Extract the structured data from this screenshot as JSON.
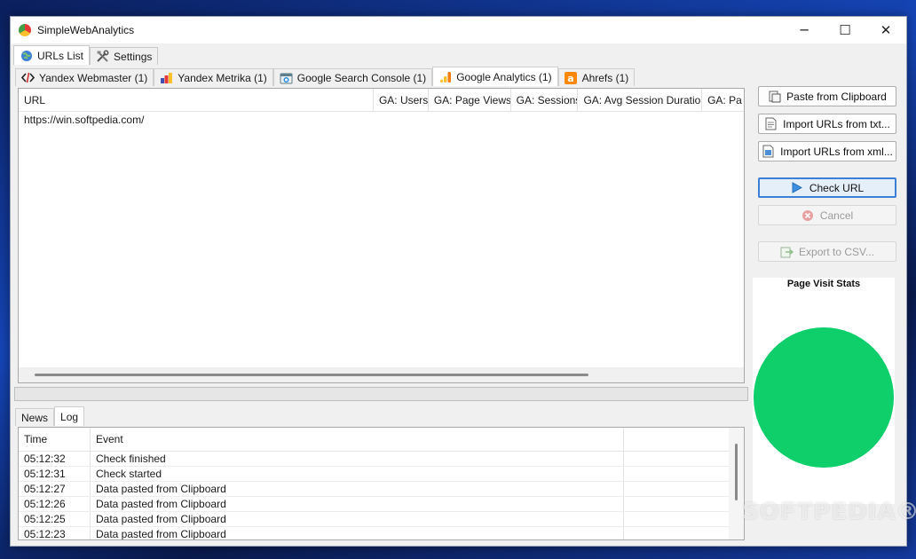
{
  "window": {
    "title": "SimpleWebAnalytics",
    "minimize": "─",
    "maximize": "☐",
    "close": "✕"
  },
  "top_tabs": [
    {
      "label": "URLs List",
      "icon": "globe-icon"
    },
    {
      "label": "Settings",
      "icon": "tools-icon"
    }
  ],
  "service_tabs": [
    {
      "label": "Yandex Webmaster (1)",
      "icon": "code-icon"
    },
    {
      "label": "Yandex Metrika (1)",
      "icon": "bar-chart-icon"
    },
    {
      "label": "Google Search Console (1)",
      "icon": "console-icon"
    },
    {
      "label": "Google Analytics (1)",
      "icon": "analytics-icon"
    },
    {
      "label": "Ahrefs (1)",
      "icon": "ahrefs-icon"
    }
  ],
  "url_table": {
    "columns": [
      "URL",
      "GA: Users",
      "GA: Page Views",
      "GA: Sessions",
      "GA: Avg Session Duration",
      "GA: Pa"
    ],
    "rows": [
      {
        "url": "https://win.softpedia.com/"
      }
    ]
  },
  "progress": {
    "fraction": 0.0,
    "color": "#06b025"
  },
  "bottom_tabs": [
    {
      "label": "News"
    },
    {
      "label": "Log"
    }
  ],
  "log_table": {
    "columns": [
      "Time",
      "Event",
      ""
    ],
    "rows": [
      {
        "time": "05:12:32",
        "event": "Check finished"
      },
      {
        "time": "05:12:31",
        "event": "Check started"
      },
      {
        "time": "05:12:27",
        "event": "Data pasted from Clipboard"
      },
      {
        "time": "05:12:26",
        "event": "Data pasted from Clipboard"
      },
      {
        "time": "05:12:25",
        "event": "Data pasted from Clipboard"
      },
      {
        "time": "05:12:23",
        "event": "Data pasted from Clipboard"
      }
    ]
  },
  "actions": {
    "paste": "Paste from Clipboard",
    "import_txt": "Import URLs from txt...",
    "import_xml": "Import URLs from xml...",
    "check": "Check URL",
    "cancel": "Cancel",
    "export": "Export to CSV..."
  },
  "chart": {
    "title": "Page Visit Stats",
    "color": "#0ecf6a"
  },
  "watermark": "SOFTPEDIA®"
}
